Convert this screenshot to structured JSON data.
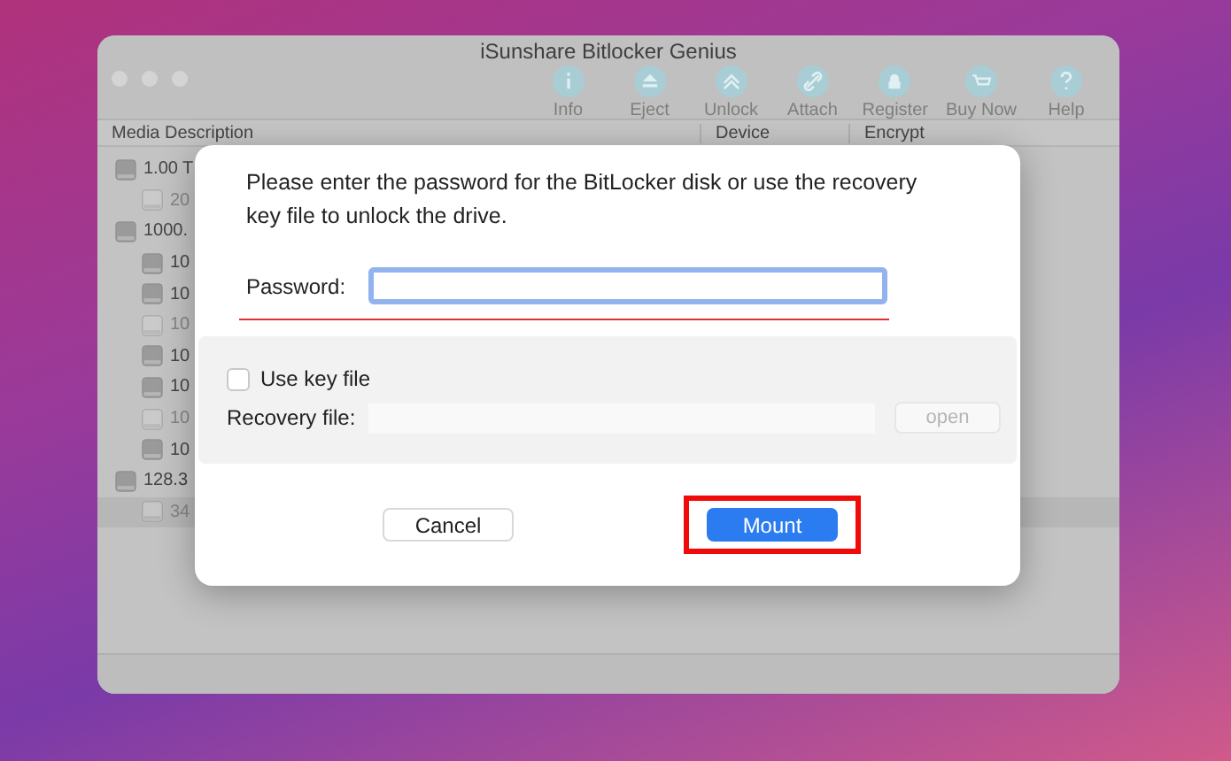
{
  "window": {
    "title": "iSunshare Bitlocker Genius"
  },
  "toolbar": [
    {
      "label": "Info",
      "kind": "info"
    },
    {
      "label": "Eject",
      "kind": "eject"
    },
    {
      "label": "Unlock",
      "kind": "unlock"
    },
    {
      "label": "Attach",
      "kind": "attach"
    },
    {
      "label": "Register",
      "kind": "register"
    },
    {
      "label": "Buy Now",
      "kind": "cart"
    },
    {
      "label": "Help",
      "kind": "help"
    }
  ],
  "table": {
    "columns": [
      "Media Description",
      "Device",
      "Encrypt"
    ],
    "rows": [
      {
        "label": "1.00 T",
        "disabled": false,
        "selected": false,
        "children": [
          {
            "label": "20",
            "disabled": true,
            "selected": false
          }
        ]
      },
      {
        "label": "1000.",
        "disabled": false,
        "selected": false,
        "children": [
          {
            "label": "10",
            "disabled": false,
            "selected": false
          },
          {
            "label": "10",
            "disabled": false,
            "selected": false
          },
          {
            "label": "10",
            "disabled": true,
            "selected": false
          },
          {
            "label": "10",
            "disabled": false,
            "selected": false
          },
          {
            "label": "10",
            "disabled": false,
            "selected": false
          },
          {
            "label": "10",
            "disabled": true,
            "selected": false
          },
          {
            "label": "10",
            "disabled": false,
            "selected": false
          }
        ]
      },
      {
        "label": "128.3",
        "disabled": false,
        "selected": false,
        "children": [
          {
            "label": "34",
            "disabled": true,
            "selected": true
          }
        ]
      }
    ]
  },
  "dialog": {
    "message": "Please enter the password for the BitLocker disk or use the recovery key file to unlock the drive.",
    "password_label": "Password:",
    "use_key_file": {
      "label": "Use key file",
      "checked": false
    },
    "recovery_label": "Recovery file:",
    "open_button": {
      "label": "open",
      "disabled": true
    },
    "buttons": [
      {
        "label": "Cancel",
        "kind": "default",
        "highlighted": false
      },
      {
        "label": "Mount",
        "kind": "primary",
        "highlighted": true
      }
    ]
  }
}
